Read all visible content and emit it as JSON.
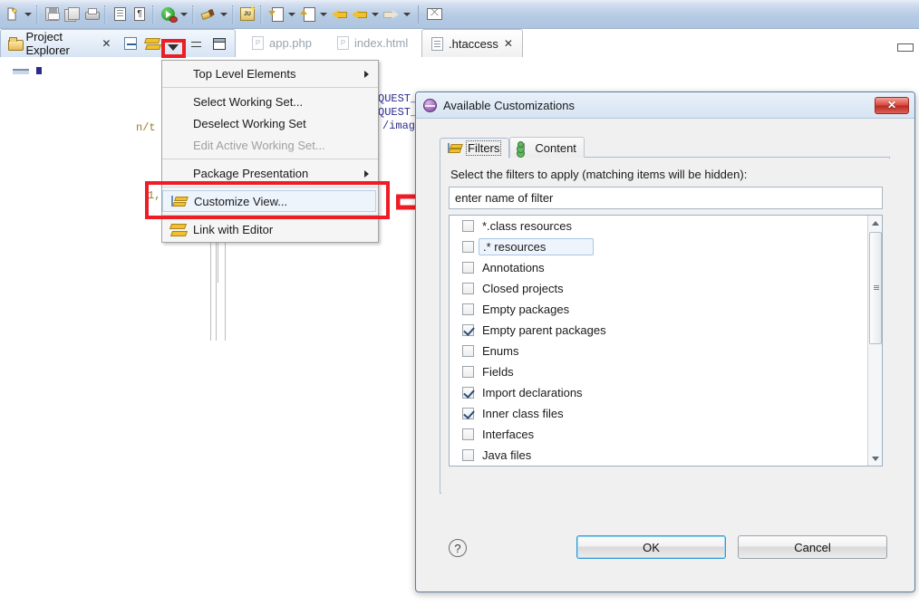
{
  "toolbar": {
    "items": [
      {
        "name": "new-wizard-icon",
        "label": "New"
      },
      {
        "name": "save-icon",
        "label": "Save"
      },
      {
        "name": "save-all-icon",
        "label": "Save All"
      },
      {
        "name": "print-icon",
        "label": "Print"
      },
      {
        "name": "toggle-block-selection-icon",
        "label": "Toggle Block Selection"
      },
      {
        "name": "show-whitespace-icon",
        "label": "Show Whitespace Characters"
      },
      {
        "name": "run-icon",
        "label": "Run"
      },
      {
        "name": "debug-icon",
        "label": "Debug"
      },
      {
        "name": "external-tools-icon",
        "label": "External Tools"
      },
      {
        "name": "junit-icon",
        "label": "New JUnit Test"
      },
      {
        "name": "previous-annotation-icon",
        "label": "Previous Annotation"
      },
      {
        "name": "next-annotation-icon",
        "label": "Next Annotation"
      },
      {
        "name": "back-icon",
        "label": "Back"
      },
      {
        "name": "forward-icon",
        "label": "Forward"
      },
      {
        "name": "open-task-icon",
        "label": "Open Task"
      }
    ]
  },
  "view_tab": {
    "title": "Project Explorer",
    "close_glyph": "✕",
    "tools": [
      {
        "name": "collapse-all-button",
        "label": "Collapse All"
      },
      {
        "name": "link-with-editor-button",
        "label": "Link with Editor"
      },
      {
        "name": "view-menu-button",
        "label": "View Menu"
      },
      {
        "name": "minimize-button",
        "label": "Minimize"
      },
      {
        "name": "maximize-button",
        "label": "Maximize"
      }
    ]
  },
  "editor_tabs": [
    {
      "label": "app.php",
      "active": false,
      "icon": "php-file-icon",
      "badge": "P"
    },
    {
      "label": "index.html",
      "active": false,
      "icon": "html-file-icon",
      "badge": "P"
    },
    {
      "label": ".htaccess",
      "active": true,
      "icon": "text-file-icon",
      "close_glyph": "✕"
    }
  ],
  "editor_background": {
    "fragments": [
      "n/t",
      "QUEST_",
      "QUEST_",
      "/imag",
      "1,"
    ]
  },
  "view_menu": {
    "items": [
      {
        "label": "Top Level Elements",
        "submenu": true,
        "disabled": false,
        "icon": null
      },
      {
        "label": "Select Working Set...",
        "submenu": false,
        "disabled": false,
        "icon": null
      },
      {
        "label": "Deselect Working Set",
        "submenu": false,
        "disabled": false,
        "icon": null
      },
      {
        "label": "Edit Active Working Set...",
        "submenu": false,
        "disabled": true,
        "icon": null
      },
      {
        "label": "Package Presentation",
        "submenu": true,
        "disabled": false,
        "icon": null
      },
      {
        "label": "Customize View...",
        "submenu": false,
        "disabled": false,
        "icon": "customize-view-icon"
      },
      {
        "label": "Link with Editor",
        "submenu": false,
        "disabled": false,
        "icon": "link-with-editor-icon"
      }
    ]
  },
  "annotations": {
    "highlight_color": "#ee1c25",
    "boxes": [
      "view-menu-button",
      "customize-view-menu-item"
    ],
    "arrow": "points-to-dialog"
  },
  "dialog": {
    "title": "Available Customizations",
    "icon": "eclipse-icon",
    "close_label": "✕",
    "tabs": [
      {
        "label": "Filters",
        "selected": true,
        "icon": "filters-icon"
      },
      {
        "label": "Content",
        "selected": false,
        "icon": "content-icon"
      }
    ],
    "instruction": "Select the filters to apply (matching items will be hidden):",
    "filter_input": {
      "value": "",
      "placeholder": "enter name of filter"
    },
    "filters": [
      {
        "label": "*.class resources",
        "checked": false,
        "selected": false
      },
      {
        "label": ".* resources",
        "checked": false,
        "selected": true
      },
      {
        "label": "Annotations",
        "checked": false,
        "selected": false
      },
      {
        "label": "Closed projects",
        "checked": false,
        "selected": false
      },
      {
        "label": "Empty packages",
        "checked": false,
        "selected": false
      },
      {
        "label": "Empty parent packages",
        "checked": true,
        "selected": false
      },
      {
        "label": "Enums",
        "checked": false,
        "selected": false
      },
      {
        "label": "Fields",
        "checked": false,
        "selected": false
      },
      {
        "label": "Import declarations",
        "checked": true,
        "selected": false
      },
      {
        "label": "Inner class files",
        "checked": true,
        "selected": false
      },
      {
        "label": "Interfaces",
        "checked": false,
        "selected": false
      },
      {
        "label": "Java files",
        "checked": false,
        "selected": false
      }
    ],
    "scrollbar": {
      "up_glyph": "▲",
      "down_glyph": "▼"
    },
    "help_label": "?",
    "buttons": {
      "ok": "OK",
      "cancel": "Cancel"
    }
  }
}
